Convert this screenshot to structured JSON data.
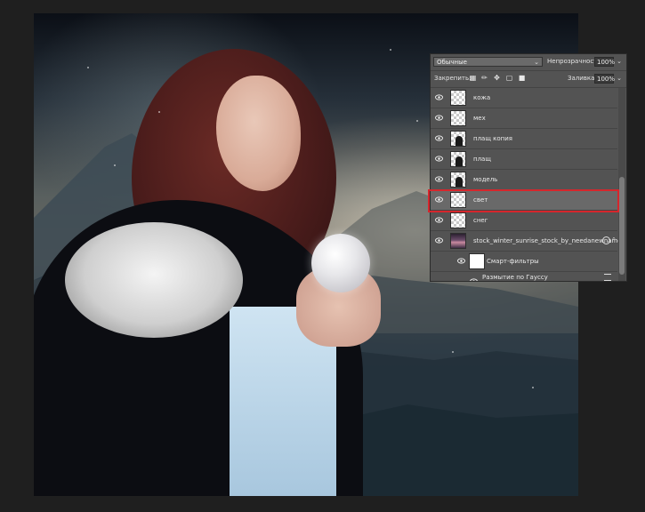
{
  "options_bar": {
    "blend_mode": "Обычные",
    "opacity_label": "Непрозрачность:",
    "opacity_value": "100%",
    "lock_label": "Закрепить:",
    "fill_label": "Заливка:",
    "fill_value": "100%"
  },
  "layers": [
    {
      "name": "кожа",
      "thumb": "transparent",
      "selected": false
    },
    {
      "name": "мех",
      "thumb": "transparent",
      "selected": false
    },
    {
      "name": "плащ копия",
      "thumb": "person",
      "selected": false
    },
    {
      "name": "плащ",
      "thumb": "person",
      "selected": false
    },
    {
      "name": "модель",
      "thumb": "person",
      "selected": false
    },
    {
      "name": "свет",
      "thumb": "transparent",
      "selected": true
    },
    {
      "name": "снег",
      "thumb": "transparent",
      "selected": false
    },
    {
      "name": "stock_winter_sunrise_stock_by_needanewname",
      "thumb": "photo",
      "selected": false
    },
    {
      "name": "Смарт-фильтры",
      "thumb": "white",
      "selected": false
    },
    {
      "name": "Размытие по Гауссу",
      "thumb": "none",
      "selected": false
    }
  ],
  "icons": {
    "visibility": "eye-icon",
    "lock_transparent": "lock-transparent-icon",
    "lock_paint": "lock-paint-icon",
    "lock_move": "lock-move-icon",
    "lock_artboard": "lock-artboard-icon",
    "lock_all": "lock-all-icon",
    "smart_object": "smart-object-icon",
    "filter_options": "filter-options-icon"
  },
  "colors": {
    "highlight": "#d6262c",
    "panel_bg": "#535353",
    "selected_layer": "#696969"
  }
}
